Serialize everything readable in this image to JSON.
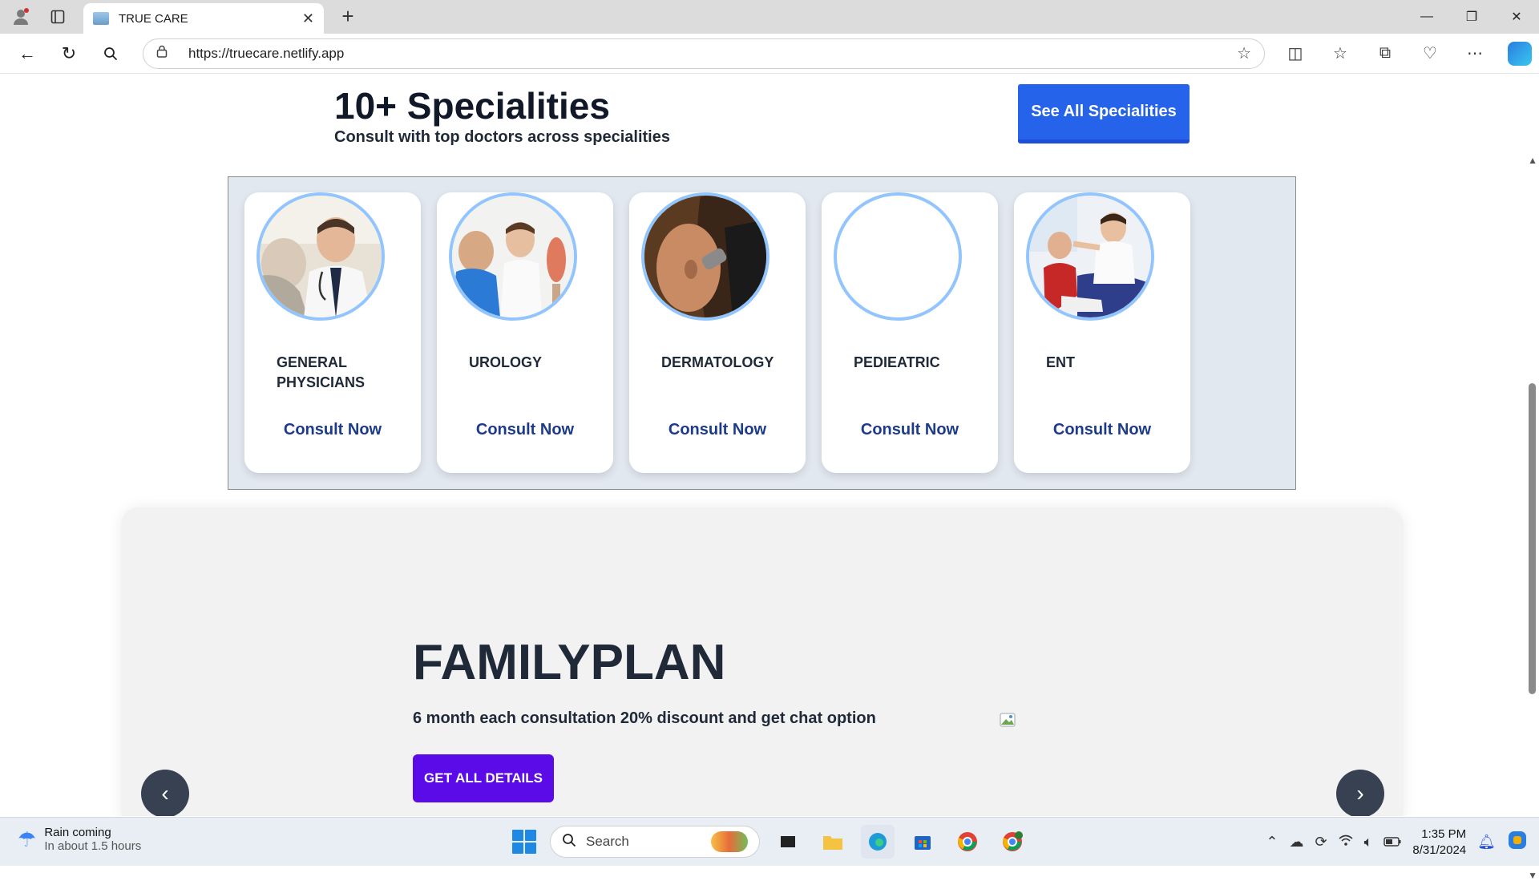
{
  "browser": {
    "tab_title": "TRUE CARE",
    "url": "https://truecare.netlify.app"
  },
  "specialities": {
    "title": "10+ Specialities",
    "subtitle": "Consult with top doctors across specialities",
    "see_all_label": "See All Specialities",
    "cards": [
      {
        "name": "GENERAL PHYSICIANS",
        "action": "Consult Now",
        "image": "doctor-with-patient"
      },
      {
        "name": "UROLOGY",
        "action": "Consult Now",
        "image": "doctor-with-model"
      },
      {
        "name": "DERMATOLOGY",
        "action": "Consult Now",
        "image": "ear-exam"
      },
      {
        "name": "PEDIEATRIC",
        "action": "Consult Now",
        "image": "empty"
      },
      {
        "name": "ENT",
        "action": "Consult Now",
        "image": "child-exam"
      }
    ]
  },
  "plan": {
    "title": "FAMILYPLAN",
    "description": "6 month each consultation 20% discount and get chat option",
    "button_label": "GET ALL DETAILS",
    "prev_icon": "‹",
    "next_icon": "›"
  },
  "taskbar": {
    "weather_title": "Rain coming",
    "weather_sub": "In about 1.5 hours",
    "search_placeholder": "Search",
    "time": "1:35 PM",
    "date": "8/31/2024"
  },
  "colors": {
    "primary_button": "#2563eb",
    "plan_button": "#5b0be8",
    "consult_text": "#1e3a8a",
    "avatar_border": "#93c5fd"
  }
}
